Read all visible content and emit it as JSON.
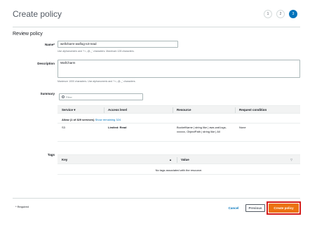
{
  "page": {
    "title": "Create policy"
  },
  "steps": [
    {
      "label": "1",
      "active": false
    },
    {
      "label": "2",
      "active": false
    },
    {
      "label": "3",
      "active": true
    }
  ],
  "review": {
    "heading": "Review policy",
    "name_label": "Name*",
    "name_value": "wellcharm-waflog-s3-read",
    "name_hint": "Use alphanumeric and '+=,.@-_' characters. Maximum 128 characters.",
    "description_label": "Description",
    "description_value": "WafCharm",
    "description_hint": "Maximum 1000 characters. Use alphanumeric and '+=,.@-_' characters."
  },
  "summary": {
    "label": "Summary",
    "filter_placeholder": "Filter",
    "columns": [
      "Service",
      "Access level",
      "Resource",
      "Request condition"
    ],
    "sort_arrow": "▾",
    "allow_text": "Allow (1 of 329 services)",
    "show_remaining": "Show remaining 324",
    "rows": [
      {
        "service": "S3",
        "access_level": "Limited: Read",
        "resource": "BucketName | string like | aws-waf-logs-xxxxxx, ObjectPath | string like | All",
        "request_condition": "None"
      }
    ]
  },
  "tags": {
    "label": "Tags",
    "columns": [
      "Key",
      "Value"
    ],
    "key_sort": "▲",
    "value_sort": "▽",
    "empty_text": "No tags associated with the resource."
  },
  "footer": {
    "required_note": "* Required",
    "cancel_label": "Cancel",
    "previous_label": "Previous",
    "create_label": "Create policy"
  },
  "colors": {
    "accent": "#0073bb",
    "primary_button": "#ec7211",
    "highlight_box": "#d41b1b"
  }
}
